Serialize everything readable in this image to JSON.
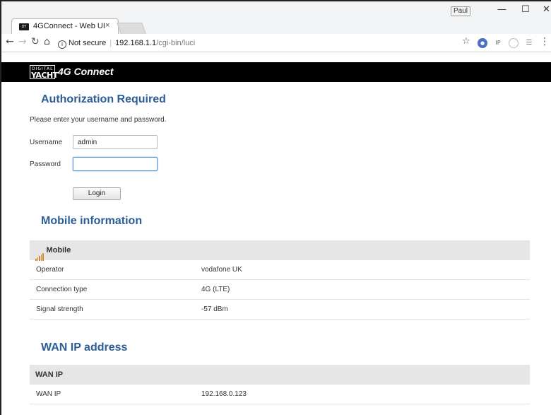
{
  "browser": {
    "tab_title": "4GConnect - Web UI",
    "tab_close": "×",
    "profile_name": "Paul",
    "window_minimize": "—",
    "window_maximize": "☐",
    "window_close": "✕",
    "security_label": "Not secure",
    "url_host": "192.168.1.1",
    "url_path": "/cgi-bin/luci",
    "extensions": [
      "ublock-icon",
      "ip-icon",
      "circle-icon",
      "checklist-icon"
    ]
  },
  "header": {
    "logo_top": "DIGITAL",
    "logo_bottom": "YACHT",
    "brand": "4G Connect"
  },
  "auth": {
    "title": "Authorization Required",
    "prompt": "Please enter your username and password.",
    "username_label": "Username",
    "username_value": "admin",
    "password_label": "Password",
    "password_value": "",
    "login_label": "Login"
  },
  "mobile": {
    "title": "Mobile information",
    "table_header": "Mobile",
    "rows": [
      {
        "key": "Operator",
        "value": "vodafone UK"
      },
      {
        "key": "Connection type",
        "value": "4G (LTE)"
      },
      {
        "key": "Signal strength",
        "value": "-57 dBm"
      }
    ]
  },
  "wan": {
    "title": "WAN IP address",
    "table_header": "WAN IP",
    "rows": [
      {
        "key": "WAN IP",
        "value": "192.168.0.123"
      }
    ]
  },
  "colors": {
    "heading": "#2b5d96",
    "header_bg": "#000000",
    "table_header_bg": "#e6e6e6",
    "signal_bars": "#d88a2a"
  }
}
